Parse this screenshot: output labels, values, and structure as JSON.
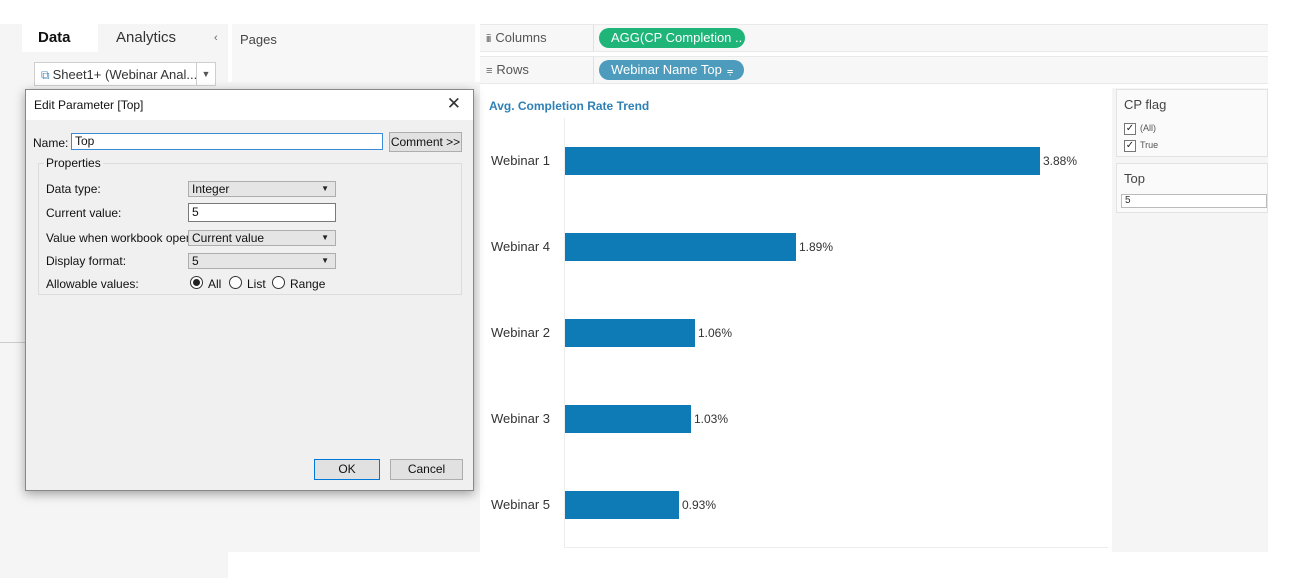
{
  "data_pane": {
    "tabs": [
      "Data",
      "Analytics"
    ],
    "collapse_icon": "chevron-left-icon",
    "datasource": "Sheet1+ (Webinar Anal..."
  },
  "pages": {
    "title": "Pages"
  },
  "shelves": {
    "columns": {
      "label": "Columns",
      "pill": "AGG(CP Completion .."
    },
    "rows": {
      "label": "Rows",
      "pill": "Webinar Name Top"
    }
  },
  "colors": {
    "bar": "#0f7bb6",
    "green_pill": "#1fb578",
    "blue_pill": "#4d9bbd",
    "title": "#2e80b5"
  },
  "chart_data": {
    "type": "bar",
    "orientation": "horizontal",
    "title": "Avg. Completion Rate Trend",
    "categories": [
      "Webinar 1",
      "Webinar 4",
      "Webinar 2",
      "Webinar 3",
      "Webinar 5"
    ],
    "values": [
      3.88,
      1.89,
      1.06,
      1.03,
      0.93
    ],
    "value_labels": [
      "3.88%",
      "1.89%",
      "1.06%",
      "1.03%",
      "0.93%"
    ],
    "xlim": [
      0,
      4.35
    ],
    "grid": false
  },
  "filters": {
    "cp_flag": {
      "title": "CP flag",
      "options": [
        {
          "label": "(All)",
          "checked": true
        },
        {
          "label": "True",
          "checked": true
        }
      ]
    },
    "top": {
      "title": "Top",
      "value": "5"
    }
  },
  "dialog": {
    "title": "Edit Parameter [Top]",
    "name_label": "Name:",
    "name_value": "Top",
    "comment_button": "Comment >>",
    "properties_label": "Properties",
    "data_type_label": "Data type:",
    "data_type_value": "Integer",
    "current_value_label": "Current value:",
    "current_value": "5",
    "workbook_opens_label": "Value when workbook opens:",
    "workbook_opens_value": "Current value",
    "display_format_label": "Display format:",
    "display_format_value": "5",
    "allowable_label": "Allowable values:",
    "allowable_options": [
      "All",
      "List",
      "Range"
    ],
    "allowable_selected": "All",
    "ok_button": "OK",
    "cancel_button": "Cancel"
  }
}
